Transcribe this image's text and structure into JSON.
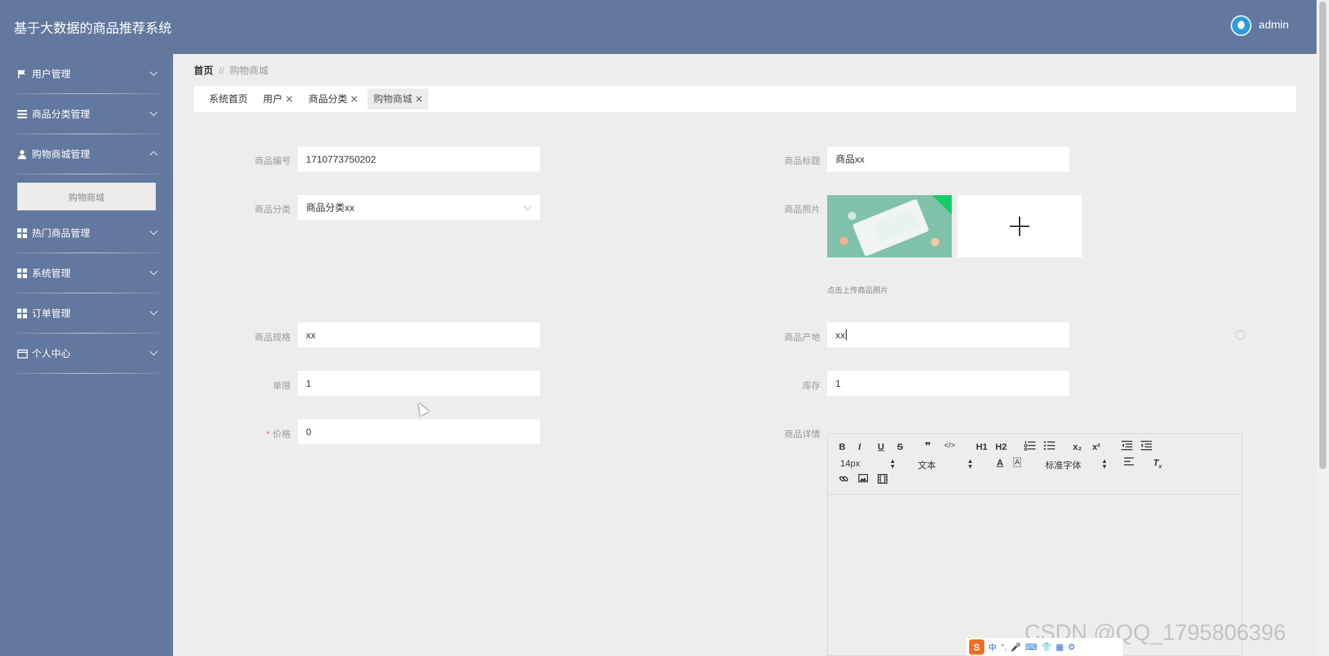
{
  "header": {
    "title": "基于大数据的商品推荐系统",
    "username": "admin"
  },
  "sidebar": {
    "items": [
      {
        "label": "用户管理",
        "icon": "flag-icon",
        "expanded": false
      },
      {
        "label": "商品分类管理",
        "icon": "list-icon",
        "expanded": false
      },
      {
        "label": "购物商城管理",
        "icon": "user-icon",
        "expanded": true,
        "children": [
          "购物商城"
        ]
      },
      {
        "label": "热门商品管理",
        "icon": "grid-icon",
        "expanded": false
      },
      {
        "label": "系统管理",
        "icon": "grid-icon",
        "expanded": false
      },
      {
        "label": "订单管理",
        "icon": "grid-icon",
        "expanded": false
      },
      {
        "label": "个人中心",
        "icon": "card-icon",
        "expanded": false
      }
    ]
  },
  "breadcrumb": {
    "home": "首页",
    "separator": "//",
    "current": "购物商城"
  },
  "tabs": [
    {
      "label": "系统首页",
      "closable": false
    },
    {
      "label": "用户",
      "closable": true
    },
    {
      "label": "商品分类",
      "closable": true
    },
    {
      "label": "购物商城",
      "closable": true,
      "active": true
    }
  ],
  "form": {
    "goods_no": {
      "label": "商品编号",
      "value": "1710773750202"
    },
    "goods_title": {
      "label": "商品标题",
      "value": "商品xx"
    },
    "category": {
      "label": "商品分类",
      "value": "商品分类xx"
    },
    "photo": {
      "label": "商品照片",
      "hint": "点击上传商品照片"
    },
    "spec": {
      "label": "商品规格",
      "value": "xx"
    },
    "origin": {
      "label": "商品产地",
      "value": "xx"
    },
    "limit": {
      "label": "单限",
      "value": "1"
    },
    "stock": {
      "label": "库存",
      "value": "1"
    },
    "price": {
      "label": "价格",
      "required_mark": "*",
      "value": "0"
    },
    "detail": {
      "label": "商品详情"
    }
  },
  "editor": {
    "buttons": [
      "B",
      "I",
      "U",
      "S",
      "❞",
      "</>",
      "H1",
      "H2",
      "x₂",
      "x²"
    ],
    "font_size": "14px",
    "block_type": "文本",
    "font_family": "标准字体"
  },
  "watermark": "CSDN @QQ_1795806396",
  "ime": {
    "logo": "S",
    "lang": "中"
  }
}
